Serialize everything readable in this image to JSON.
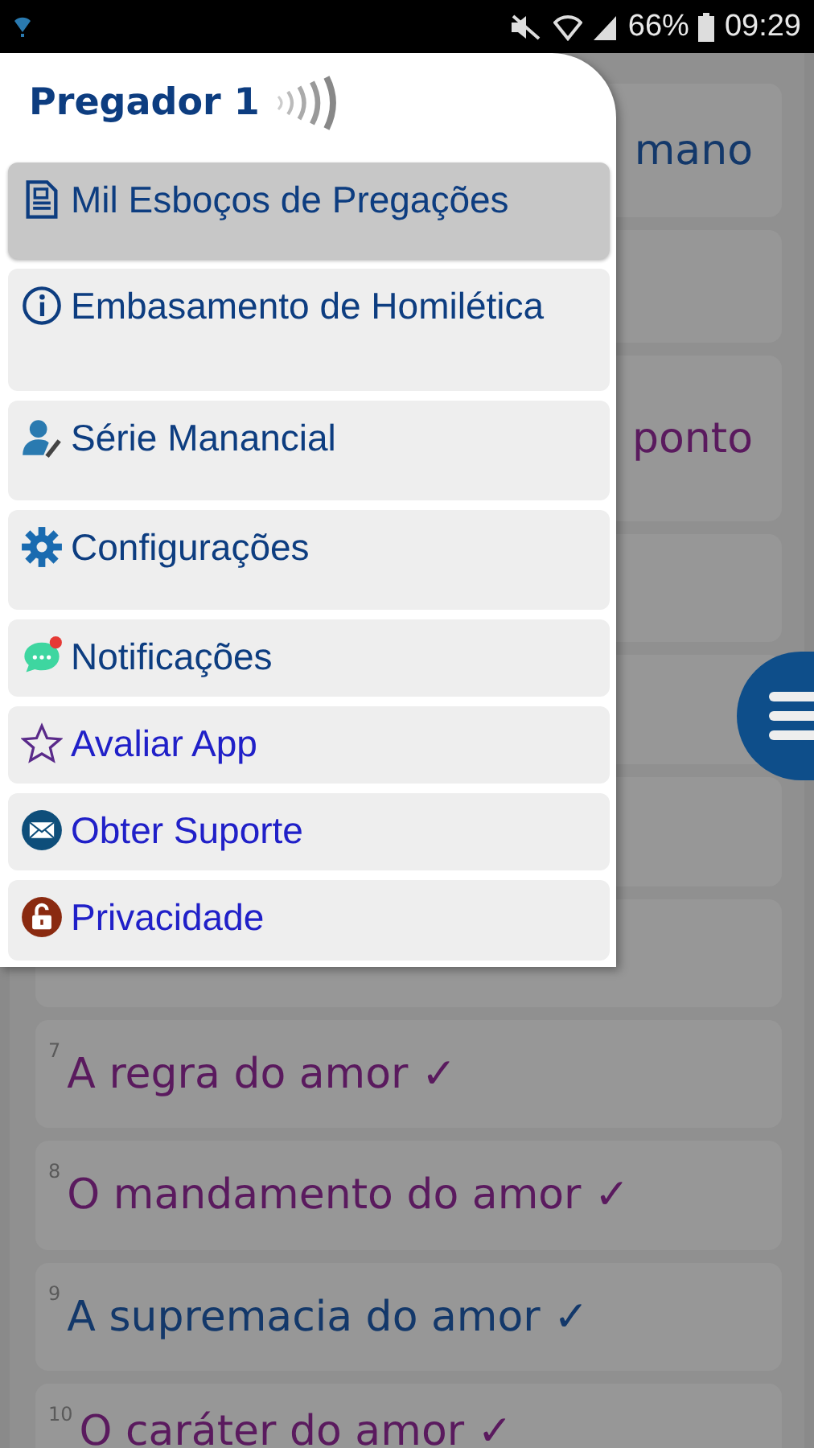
{
  "status_bar": {
    "battery": "66%",
    "time": "09:29"
  },
  "background_list": [
    {
      "kind": "fragment",
      "text": "mano",
      "color": "#13386a"
    },
    {
      "kind": "covered"
    },
    {
      "kind": "fragment",
      "text": "ponto",
      "color": "#5a1a5e"
    },
    {
      "kind": "covered"
    },
    {
      "kind": "covered"
    },
    {
      "kind": "covered"
    },
    {
      "kind": "covered"
    },
    {
      "kind": "item",
      "number": "7",
      "text": "A regra do amor ✓",
      "color": "#5a1a5e"
    },
    {
      "kind": "item",
      "number": "8",
      "text": "O mandamento do amor ✓",
      "color": "#5a1a5e"
    },
    {
      "kind": "item",
      "number": "9",
      "text": "A supremacia do amor ✓",
      "color": "#13386a"
    },
    {
      "kind": "item",
      "number": "10",
      "text": "O caráter do amor ✓",
      "color": "#5a1a5e"
    }
  ],
  "drawer": {
    "title": "Pregador 1",
    "items": [
      {
        "label": "Mil Esboços de Pregações",
        "selected": true,
        "color": "#0d3d80"
      },
      {
        "label": "Embasamento de Homilética",
        "selected": false,
        "color": "#0d3d80"
      },
      {
        "label": "Série Manancial",
        "selected": false,
        "color": "#0d3d80"
      },
      {
        "label": "Configurações",
        "selected": false,
        "color": "#0d3d80"
      },
      {
        "label": "Notificações",
        "selected": false,
        "color": "#0d3d80"
      },
      {
        "label": "Avaliar App",
        "selected": false,
        "color": "#2020c8"
      },
      {
        "label": "Obter Suporte",
        "selected": false,
        "color": "#2020c8"
      },
      {
        "label": "Privacidade",
        "selected": false,
        "color": "#2020c8"
      }
    ]
  }
}
